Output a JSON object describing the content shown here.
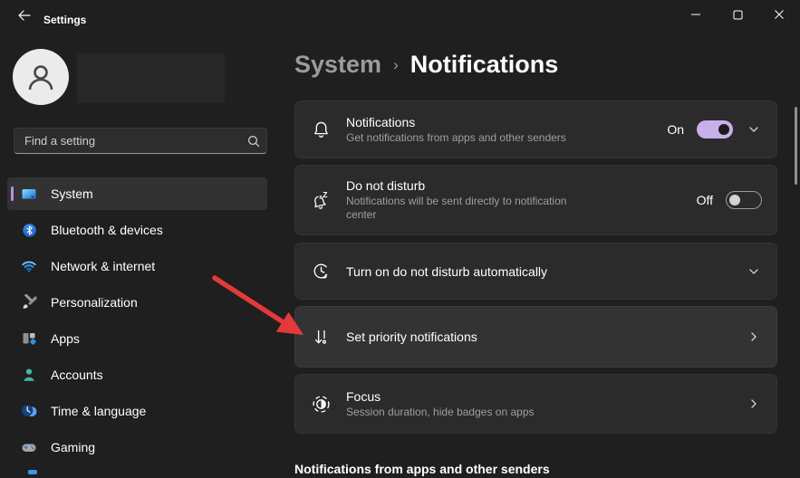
{
  "titlebar": {
    "title": "Settings"
  },
  "sidebar": {
    "search_placeholder": "Find a setting",
    "items": [
      {
        "label": "System",
        "selected": true
      },
      {
        "label": "Bluetooth & devices",
        "selected": false
      },
      {
        "label": "Network & internet",
        "selected": false
      },
      {
        "label": "Personalization",
        "selected": false
      },
      {
        "label": "Apps",
        "selected": false
      },
      {
        "label": "Accounts",
        "selected": false
      },
      {
        "label": "Time & language",
        "selected": false
      },
      {
        "label": "Gaming",
        "selected": false
      }
    ]
  },
  "main": {
    "breadcrumb": {
      "parent": "System",
      "separator": "›",
      "current": "Notifications"
    },
    "cards": [
      {
        "icon": "bell-icon",
        "title": "Notifications",
        "subtitle": "Get notifications from apps and other senders",
        "toggle_label": "On",
        "toggle_state": "on",
        "chevron": "down"
      },
      {
        "icon": "bell-snooze-icon",
        "title": "Do not disturb",
        "subtitle": "Notifications will be sent directly to notification center",
        "toggle_label": "Off",
        "toggle_state": "off",
        "chevron": "none"
      },
      {
        "icon": "clock-history-icon",
        "title": "Turn on do not disturb automatically",
        "chevron": "down"
      },
      {
        "icon": "priority-notifications-icon",
        "title": "Set priority notifications",
        "chevron": "right",
        "hovered": true
      },
      {
        "icon": "focus-icon",
        "title": "Focus",
        "subtitle": "Session duration, hide badges on apps",
        "chevron": "right"
      }
    ],
    "section_header": "Notifications from apps and other senders"
  },
  "colors": {
    "accent_toggle_on": "#c8b0e8",
    "nav_selection_bar": "#b78fe6",
    "annotation_arrow": "#e23a3a",
    "card_background": "#2b2b2b"
  },
  "annotation": {
    "type": "arrow",
    "points_to": "Set priority notifications"
  }
}
